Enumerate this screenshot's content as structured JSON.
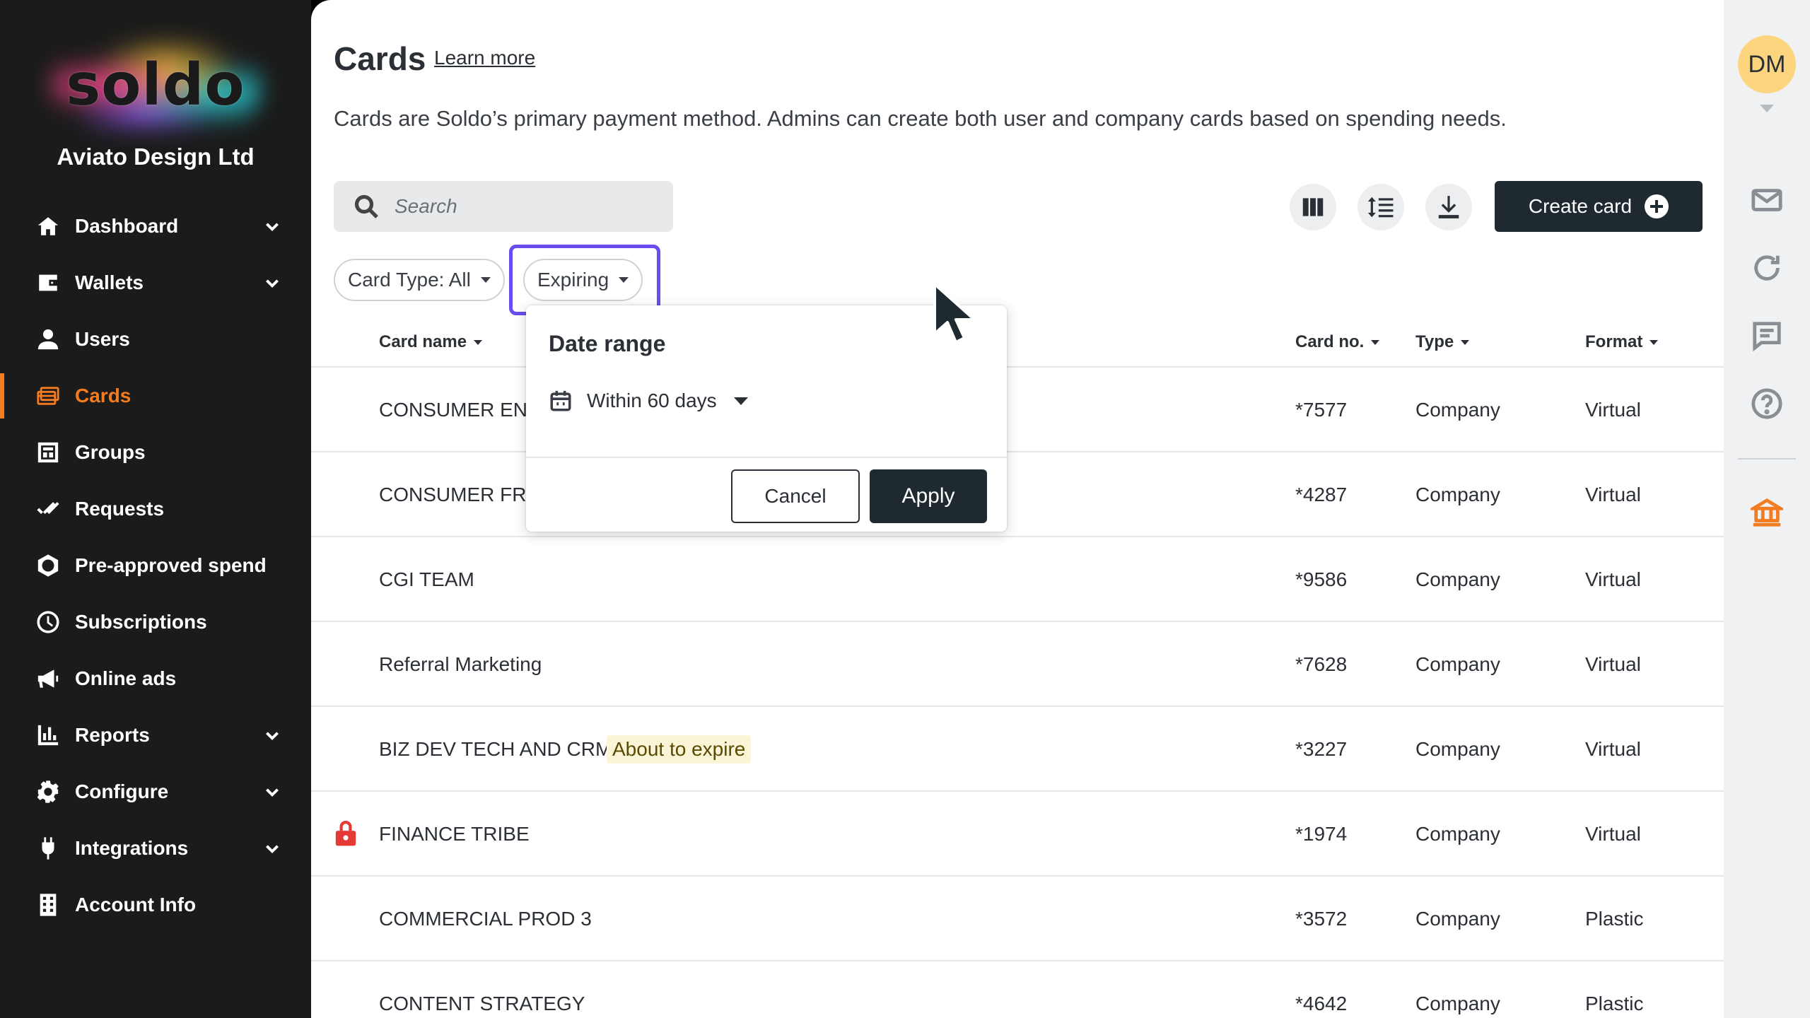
{
  "sidebar": {
    "logo": "soldo",
    "company": "Aviato Design Ltd",
    "items": [
      {
        "label": "Dashboard"
      },
      {
        "label": "Wallets"
      },
      {
        "label": "Users"
      },
      {
        "label": "Cards"
      },
      {
        "label": "Groups"
      },
      {
        "label": "Requests"
      },
      {
        "label": "Pre-approved spend"
      },
      {
        "label": "Subscriptions"
      },
      {
        "label": "Online ads"
      },
      {
        "label": "Reports"
      },
      {
        "label": "Configure"
      },
      {
        "label": "Integrations"
      },
      {
        "label": "Account Info"
      }
    ]
  },
  "header": {
    "title": "Cards",
    "learn_more": "Learn more",
    "description": "Cards are Soldo’s primary payment method. Admins can create both user and company cards based on spending needs."
  },
  "search": {
    "placeholder": "Search"
  },
  "toolbar": {
    "create_label": "Create card"
  },
  "filters": {
    "card_type": "Card Type: All",
    "expiring": "Expiring"
  },
  "table": {
    "columns": {
      "card_name": "Card name",
      "card_no": "Card no.",
      "type": "Type",
      "format": "Format"
    },
    "rows": [
      {
        "name": "CONSUMER ENG",
        "no": "*7577",
        "type": "Company",
        "format": "Virtual",
        "badge": "",
        "locked": false
      },
      {
        "name": "CONSUMER FRO",
        "no": "*4287",
        "type": "Company",
        "format": "Virtual",
        "badge": "",
        "locked": false
      },
      {
        "name": "CGI TEAM",
        "no": "*9586",
        "type": "Company",
        "format": "Virtual",
        "badge": "",
        "locked": false
      },
      {
        "name": "Referral Marketing",
        "no": "*7628",
        "type": "Company",
        "format": "Virtual",
        "badge": "",
        "locked": false
      },
      {
        "name": "BIZ DEV TECH AND CRM",
        "no": "*3227",
        "type": "Company",
        "format": "Virtual",
        "badge": "About to expire",
        "locked": false
      },
      {
        "name": "FINANCE TRIBE",
        "no": "*1974",
        "type": "Company",
        "format": "Virtual",
        "badge": "",
        "locked": true
      },
      {
        "name": "COMMERCIAL PROD 3",
        "no": "*3572",
        "type": "Company",
        "format": "Plastic",
        "badge": "",
        "locked": false
      },
      {
        "name": "CONTENT STRATEGY",
        "no": "*4642",
        "type": "Company",
        "format": "Plastic",
        "badge": "",
        "locked": false
      }
    ]
  },
  "popup": {
    "title": "Date range",
    "range_value": "Within 60 days",
    "cancel": "Cancel",
    "apply": "Apply"
  },
  "user": {
    "initials": "DM"
  },
  "colors": {
    "accent": "#f47b20",
    "focus": "#6a4cf0",
    "dark_button": "#1f2a30",
    "badge_bg": "#fbf5d8",
    "lock": "#e53935"
  }
}
